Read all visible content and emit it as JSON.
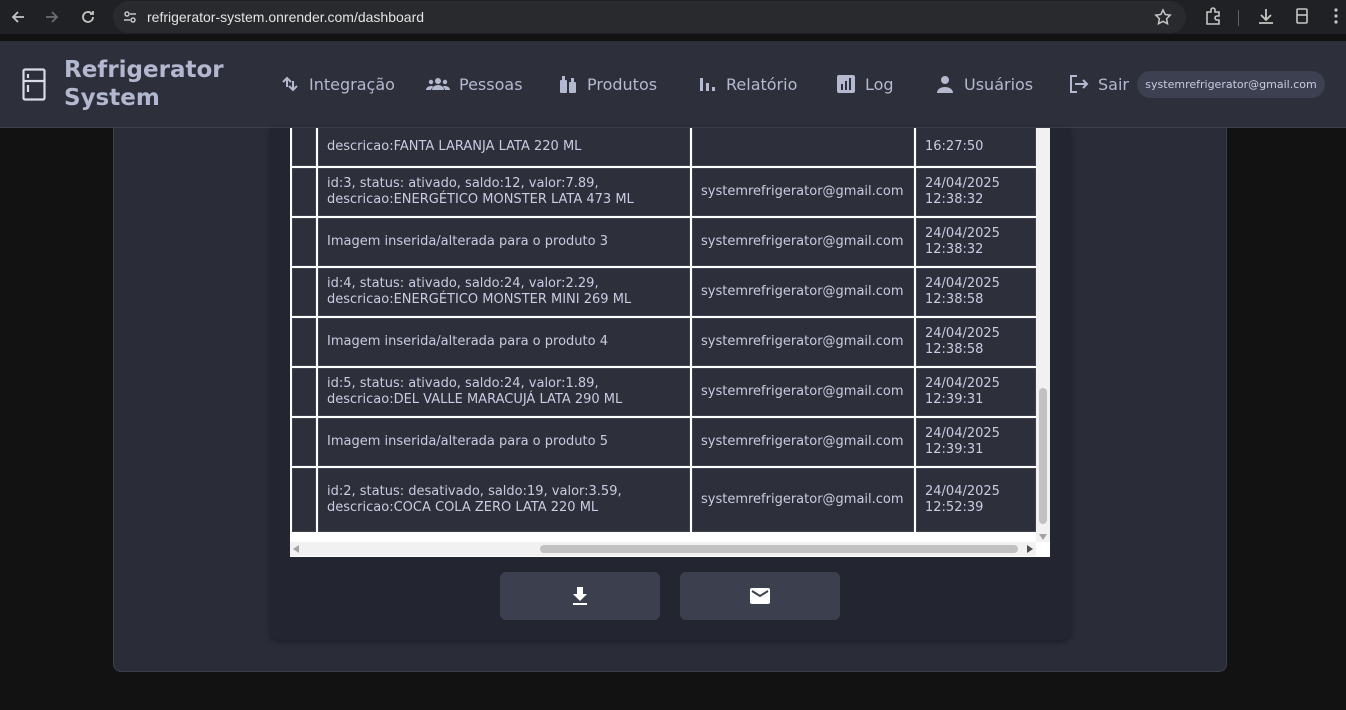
{
  "browser": {
    "url": "refrigerator-system.onrender.com/dashboard"
  },
  "header": {
    "brand_line1": "Refrigerator",
    "brand_line2": "System",
    "nav": [
      {
        "label": "Integração",
        "icon": "integration-icon"
      },
      {
        "label": "Pessoas",
        "icon": "people-icon"
      },
      {
        "label": "Produtos",
        "icon": "products-icon"
      },
      {
        "label": "Relatório",
        "icon": "bar-chart-icon"
      },
      {
        "label": "Log",
        "icon": "log-icon"
      },
      {
        "label": "Usuários",
        "icon": "user-icon"
      },
      {
        "label": "Sair",
        "icon": "logout-icon"
      }
    ],
    "user_email": "systemrefrigerator@gmail.com"
  },
  "log": {
    "rows": [
      {
        "description_lines": [
          "descricao:FANTA LARANJA LATA 220 ML"
        ],
        "user": "",
        "date": "",
        "time": "16:27:50"
      },
      {
        "description_lines": [
          "id:3, status: ativado, saldo:12, valor:7.89,",
          "descricao:ENERGÉTICO MONSTER LATA 473 ML"
        ],
        "user": "systemrefrigerator@gmail.com",
        "date": "24/04/2025",
        "time": "12:38:32"
      },
      {
        "description_lines": [
          "Imagem inserida/alterada para o produto 3"
        ],
        "user": "systemrefrigerator@gmail.com",
        "date": "24/04/2025",
        "time": "12:38:32"
      },
      {
        "description_lines": [
          "id:4, status: ativado, saldo:24, valor:2.29,",
          "descricao:ENERGÉTICO MONSTER MINI 269 ML"
        ],
        "user": "systemrefrigerator@gmail.com",
        "date": "24/04/2025",
        "time": "12:38:58"
      },
      {
        "description_lines": [
          "Imagem inserida/alterada para o produto 4"
        ],
        "user": "systemrefrigerator@gmail.com",
        "date": "24/04/2025",
        "time": "12:38:58"
      },
      {
        "description_lines": [
          "id:5, status: ativado, saldo:24, valor:1.89,",
          "descricao:DEL VALLE MARACUJÁ LATA 290 ML"
        ],
        "user": "systemrefrigerator@gmail.com",
        "date": "24/04/2025",
        "time": "12:39:31"
      },
      {
        "description_lines": [
          "Imagem inserida/alterada para o produto 5"
        ],
        "user": "systemrefrigerator@gmail.com",
        "date": "24/04/2025",
        "time": "12:39:31"
      },
      {
        "description_lines": [
          "id:2, status: desativado, saldo:19, valor:3.59,",
          "descricao:COCA COLA ZERO LATA 220 ML"
        ],
        "user": "systemrefrigerator@gmail.com",
        "date": "24/04/2025",
        "time": "12:52:39"
      }
    ]
  },
  "actions": {
    "download_icon": "download-icon",
    "email_icon": "mail-icon"
  }
}
